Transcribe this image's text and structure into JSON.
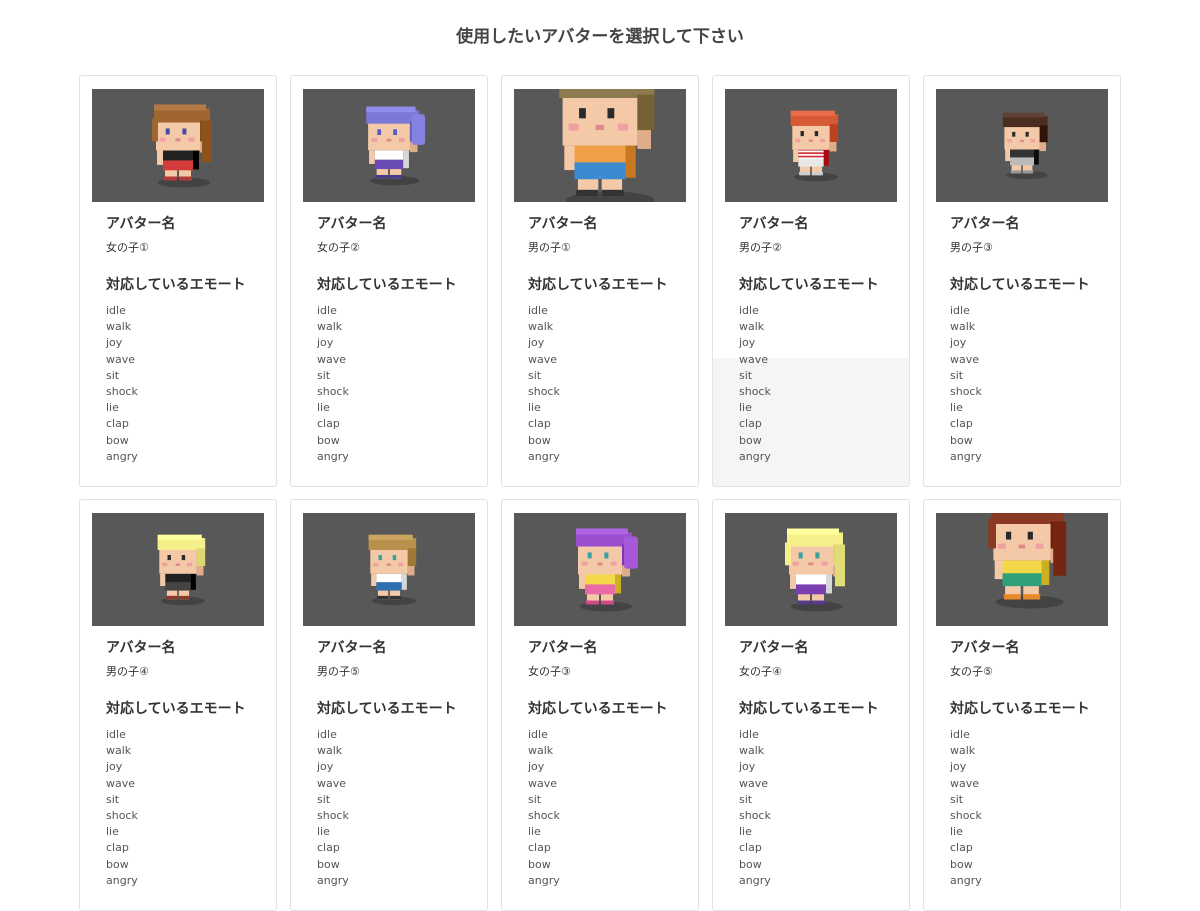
{
  "page": {
    "title": "使用したいアバターを選択して下さい",
    "name_heading": "アバター名",
    "emote_heading": "対応しているエモート"
  },
  "colors": {
    "thumb_bg": "#585858",
    "card_border": "#e2e2e2",
    "hover_bg": "#f5f5f5"
  },
  "avatars": [
    {
      "name": "女の子①",
      "hair": "#a0662f",
      "top": "#222222",
      "bottom": "#d43b3b",
      "shoes": "#b33a3a",
      "eyes": "#4a4aa8",
      "style": "girl-long",
      "scale": 1.0,
      "emotes": [
        "idle",
        "walk",
        "joy",
        "wave",
        "sit",
        "shock",
        "lie",
        "clap",
        "bow",
        "angry"
      ]
    },
    {
      "name": "女の子②",
      "hair": "#7b78d6",
      "top": "#ffffff",
      "bottom": "#6a4bb3",
      "shoes": "#4a3b8a",
      "eyes": "#5a5ad0",
      "style": "girl-pony",
      "scale": 0.95,
      "emotes": [
        "idle",
        "walk",
        "joy",
        "wave",
        "sit",
        "shock",
        "lie",
        "clap",
        "bow",
        "angry"
      ]
    },
    {
      "name": "男の子①",
      "hair": "#8d7a4f",
      "top": "#f0a046",
      "bottom": "#3c8ad0",
      "shoes": "#333333",
      "eyes": "#2a2a2a",
      "style": "boy-big",
      "scale": 1.7,
      "emotes": [
        "idle",
        "walk",
        "joy",
        "wave",
        "sit",
        "shock",
        "lie",
        "clap",
        "bow",
        "angry"
      ]
    },
    {
      "name": "男の子②",
      "hair": "#d65a36",
      "top": "#d0343a",
      "bottom": "#e8e8e8",
      "shoes": "#cccccc",
      "eyes": "#2a2a2a",
      "style": "boy-stripe",
      "scale": 0.85,
      "emotes": [
        "idle",
        "walk",
        "joy",
        "wave",
        "sit",
        "shock",
        "lie",
        "clap",
        "bow",
        "angry"
      ]
    },
    {
      "name": "男の子③",
      "hair": "#4a2d20",
      "top": "#333333",
      "bottom": "#bbbbbb",
      "shoes": "#999999",
      "eyes": "#2a2a2a",
      "style": "boy",
      "scale": 0.8,
      "emotes": [
        "idle",
        "walk",
        "joy",
        "wave",
        "sit",
        "shock",
        "lie",
        "clap",
        "bow",
        "angry"
      ]
    },
    {
      "name": "男の子④",
      "hair": "#f5f08a",
      "top": "#222222",
      "bottom": "#444444",
      "shoes": "#8a3a2a",
      "eyes": "#2a2a2a",
      "style": "boy",
      "scale": 0.85,
      "emotes": [
        "idle",
        "walk",
        "joy",
        "wave",
        "sit",
        "shock",
        "lie",
        "clap",
        "bow",
        "angry"
      ]
    },
    {
      "name": "男の子⑤",
      "hair": "#b8924c",
      "top": "#ffffff",
      "bottom": "#2f6fb0",
      "shoes": "#333333",
      "eyes": "#3aa0a0",
      "style": "boy",
      "scale": 0.85,
      "emotes": [
        "idle",
        "walk",
        "joy",
        "wave",
        "sit",
        "shock",
        "lie",
        "clap",
        "bow",
        "angry"
      ]
    },
    {
      "name": "女の子③",
      "hair": "#9b4fcf",
      "top": "#f3d94a",
      "bottom": "#e86aa6",
      "shoes": "#d04a8a",
      "eyes": "#3aa0a0",
      "style": "girl-pony",
      "scale": 1.0,
      "emotes": [
        "idle",
        "walk",
        "joy",
        "wave",
        "sit",
        "shock",
        "lie",
        "clap",
        "bow",
        "angry"
      ]
    },
    {
      "name": "女の子④",
      "hair": "#f5f08a",
      "top": "#ffffff",
      "bottom": "#7a3fb0",
      "shoes": "#5a3a8a",
      "eyes": "#3aa0a0",
      "style": "girl-long",
      "scale": 1.0,
      "emotes": [
        "idle",
        "walk",
        "joy",
        "wave",
        "sit",
        "shock",
        "lie",
        "clap",
        "bow",
        "angry"
      ]
    },
    {
      "name": "女の子⑤",
      "hair": "#8a3a24",
      "top": "#f3d94a",
      "bottom": "#2fa07a",
      "shoes": "#e88a2a",
      "eyes": "#2a2a2a",
      "style": "girl-big",
      "scale": 1.3,
      "emotes": [
        "idle",
        "walk",
        "joy",
        "wave",
        "sit",
        "shock",
        "lie",
        "clap",
        "bow",
        "angry"
      ]
    }
  ],
  "hovered_index": 3
}
